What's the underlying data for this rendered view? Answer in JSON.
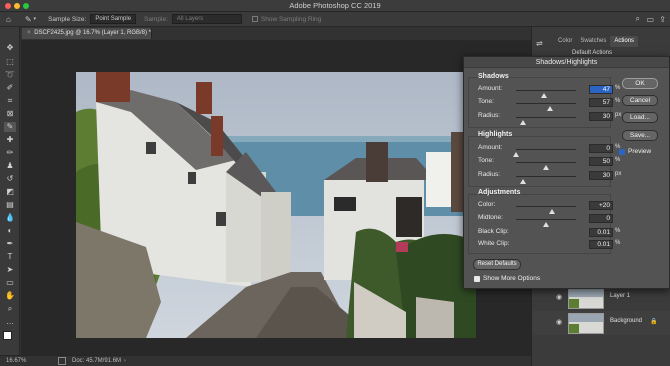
{
  "app": {
    "title": "Adobe Photoshop CC 2019",
    "traffic_colors": [
      "#fe5f57",
      "#febc2e",
      "#28c840"
    ]
  },
  "options_bar": {
    "sample_size_label": "Sample Size:",
    "sample_size_value": "Point Sample",
    "sample_label": "Sample:",
    "sample_value": "All Layers",
    "show_ring_label": "Show Sampling Ring"
  },
  "document": {
    "tab_title": "DSCF2425.jpg @ 16.7% (Layer 1, RGB/8) *"
  },
  "status_bar": {
    "zoom": "16.67%",
    "doc_info": "Doc: 45.7M/91.6M"
  },
  "panels": {
    "tabs": [
      "Color",
      "Swatches",
      "Actions"
    ],
    "actions_item": "Default Actions",
    "layers": [
      {
        "name": "Layer 1"
      },
      {
        "name": "Background"
      }
    ]
  },
  "dialog": {
    "title": "Shadows/Highlights",
    "shadows": {
      "heading": "Shadows",
      "amount": {
        "label": "Amount:",
        "value": "47",
        "unit": "%",
        "pos": 0.47
      },
      "tone": {
        "label": "Tone:",
        "value": "57",
        "unit": "%",
        "pos": 0.57
      },
      "radius": {
        "label": "Radius:",
        "value": "30",
        "unit": "px",
        "pos": 0.12
      }
    },
    "highlights": {
      "heading": "Highlights",
      "amount": {
        "label": "Amount:",
        "value": "0",
        "unit": "%",
        "pos": 0.0
      },
      "tone": {
        "label": "Tone:",
        "value": "50",
        "unit": "%",
        "pos": 0.5
      },
      "radius": {
        "label": "Radius:",
        "value": "30",
        "unit": "px",
        "pos": 0.12
      }
    },
    "adjustments": {
      "heading": "Adjustments",
      "color": {
        "label": "Color:",
        "value": "+20",
        "unit": "",
        "pos": 0.6
      },
      "midtone": {
        "label": "Midtone:",
        "value": "0",
        "unit": "",
        "pos": 0.5
      },
      "black_clip": {
        "label": "Black Clip:",
        "value": "0.01",
        "unit": "%"
      },
      "white_clip": {
        "label": "White Clip:",
        "value": "0.01",
        "unit": "%"
      }
    },
    "buttons": {
      "ok": "OK",
      "cancel": "Cancel",
      "load": "Load...",
      "save": "Save...",
      "preview": "Preview",
      "reset": "Reset Defaults",
      "show_more": "Show More Options"
    }
  }
}
